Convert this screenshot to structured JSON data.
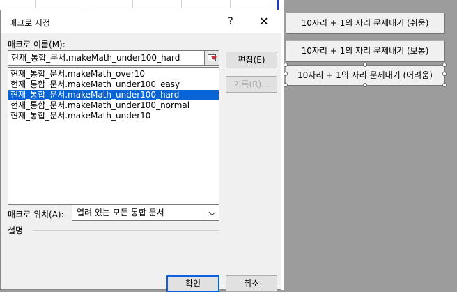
{
  "dialog": {
    "title": "매크로 지정",
    "help_label": "?",
    "close_label": "✕",
    "name_label": "매크로 이름(M):",
    "name_value": "현재_통합_문서.makeMath_under100_hard",
    "macros": [
      "현재_통합_문서.makeMath_over10",
      "현재_통합_문서.makeMath_under100_easy",
      "현재_통합_문서.makeMath_under100_hard",
      "현재_통합_문서.makeMath_under100_normal",
      "현재_통합_문서.makeMath_under10"
    ],
    "selected_index": 2,
    "edit_label": "편집(E)",
    "record_label": "기록(R)...",
    "location_label": "매크로 위치(A):",
    "location_value": "열려 있는 모든 통합 문서",
    "description_label": "설명",
    "ok_label": "확인",
    "cancel_label": "취소"
  },
  "sheet": {
    "buttons": [
      "10자리 + 1의 자리 문제내기 (쉬움)",
      "10자리 + 1의 자리 문제내기 (보통)",
      "10자리 + 1의 자리 문제내기 (어려움)"
    ]
  },
  "colors": {
    "selection": "#0a64d6",
    "background": "#9c9c9c"
  }
}
